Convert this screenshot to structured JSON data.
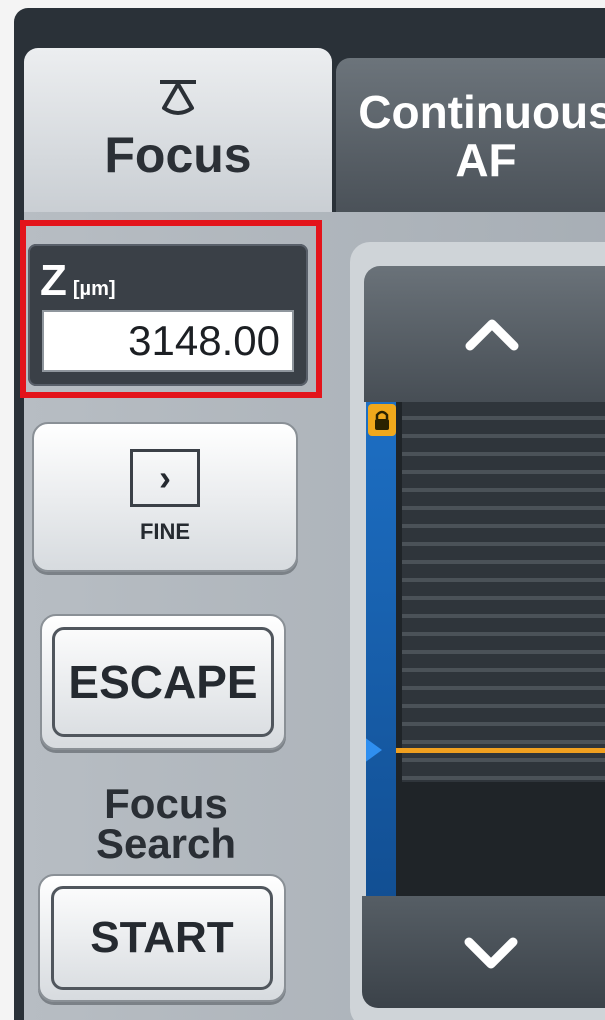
{
  "tabs": [
    {
      "label": "Focus",
      "icon": "focus-lamp-icon",
      "active": true
    },
    {
      "label": "Continuous\nAF",
      "active": false
    }
  ],
  "z_readout": {
    "axis": "Z",
    "unit": "[µm]",
    "value": "3148.00"
  },
  "buttons": {
    "fine_icon": "chevron-right-icon",
    "fine_label": "FINE",
    "escape_label": "ESCAPE",
    "focus_search_label": "Focus\nSearch",
    "start_label": "START"
  },
  "slider": {
    "up_icon": "chevron-up-icon",
    "down_icon": "chevron-down-icon",
    "lock_icon": "lock-icon",
    "position_fraction": 0.7
  },
  "colors": {
    "accent_blue": "#1d6fc4",
    "position_line": "#f0a020",
    "highlight": "#e3141b"
  }
}
